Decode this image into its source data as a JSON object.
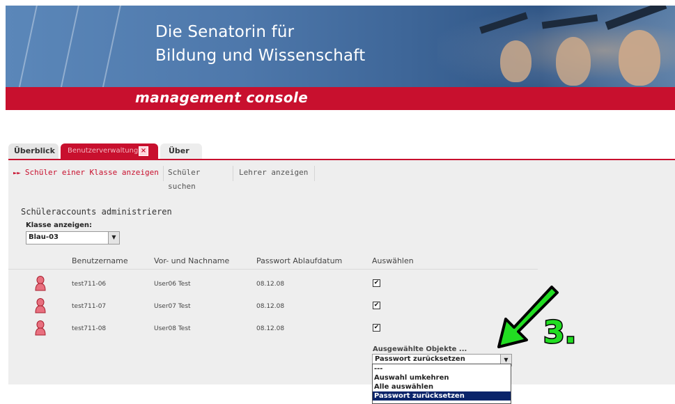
{
  "banner": {
    "title_line1": "Die Senatorin für",
    "title_line2": "Bildung und Wissenschaft",
    "subtitle": "management console"
  },
  "tabs": [
    {
      "label": "Überblick"
    },
    {
      "label": "Benutzerverwaltung",
      "active": true
    },
    {
      "label": "Über"
    }
  ],
  "subnav": [
    {
      "label": "Schüler einer Klasse anzeigen",
      "active": true
    },
    {
      "label": "Schüler suchen"
    },
    {
      "label": "Lehrer anzeigen"
    }
  ],
  "main": {
    "title": "Schüleraccounts administrieren",
    "class_label": "Klasse anzeigen:",
    "class_value": "Blau-03",
    "columns": [
      "Benutzername",
      "Vor- und Nachname",
      "Passwort Ablaufdatum",
      "Auswählen"
    ],
    "rows": [
      {
        "username": "test711-06",
        "fullname": "User06 Test",
        "expiry": "08.12.08",
        "checked": true
      },
      {
        "username": "test711-07",
        "fullname": "User07 Test",
        "expiry": "08.12.08",
        "checked": true
      },
      {
        "username": "test711-08",
        "fullname": "User08 Test",
        "expiry": "08.12.08",
        "checked": true
      }
    ],
    "selected_label": "Ausgewählte Objekte ...",
    "action_value": "Passwort zurücksetzen",
    "action_options": [
      "---",
      "Auswahl umkehren",
      "Alle auswählen",
      "Passwort zurücksetzen"
    ]
  },
  "annotation": {
    "step": "3."
  },
  "colors": {
    "brand_red": "#c8102e",
    "annotation_green": "#22dd22",
    "selection_blue": "#0a246a"
  },
  "icons": {
    "tab_close": "close-icon",
    "user": "user-icon",
    "arrow": "arrow-icon"
  }
}
